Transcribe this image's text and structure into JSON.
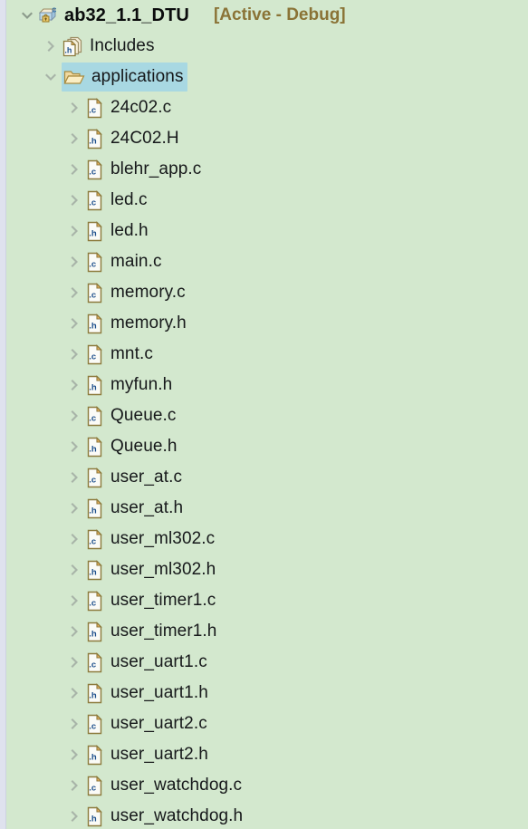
{
  "panel": {
    "name": "project-explorer",
    "background_color": "#d3e8ce",
    "selection_color": "#a8d8e2",
    "text_color": "#16181a",
    "build_config_color": "#8a7336"
  },
  "project": {
    "name": "ab32_1.1_DTU",
    "build_config": "[Active - Debug]",
    "icon": "c-project-icon",
    "expanded": true
  },
  "nodes": [
    {
      "label": "Includes",
      "icon": "includes-icon",
      "level": 1,
      "state": "collapsed",
      "selected": false
    },
    {
      "label": "applications",
      "icon": "folder-open-icon",
      "level": 1,
      "state": "expanded",
      "selected": true
    },
    {
      "label": "24c02.c",
      "icon": "c-file-icon",
      "level": 2,
      "state": "collapsed",
      "selected": false
    },
    {
      "label": "24C02.H",
      "icon": "h-file-icon",
      "level": 2,
      "state": "collapsed",
      "selected": false
    },
    {
      "label": "blehr_app.c",
      "icon": "c-file-icon",
      "level": 2,
      "state": "collapsed",
      "selected": false
    },
    {
      "label": "led.c",
      "icon": "c-file-icon",
      "level": 2,
      "state": "collapsed",
      "selected": false
    },
    {
      "label": "led.h",
      "icon": "h-file-icon",
      "level": 2,
      "state": "collapsed",
      "selected": false
    },
    {
      "label": "main.c",
      "icon": "c-file-icon",
      "level": 2,
      "state": "collapsed",
      "selected": false
    },
    {
      "label": "memory.c",
      "icon": "c-file-icon",
      "level": 2,
      "state": "collapsed",
      "selected": false
    },
    {
      "label": "memory.h",
      "icon": "h-file-icon",
      "level": 2,
      "state": "collapsed",
      "selected": false
    },
    {
      "label": "mnt.c",
      "icon": "c-file-icon",
      "level": 2,
      "state": "collapsed",
      "selected": false
    },
    {
      "label": "myfun.h",
      "icon": "h-file-icon",
      "level": 2,
      "state": "collapsed",
      "selected": false
    },
    {
      "label": "Queue.c",
      "icon": "c-file-icon",
      "level": 2,
      "state": "collapsed",
      "selected": false
    },
    {
      "label": "Queue.h",
      "icon": "h-file-icon",
      "level": 2,
      "state": "collapsed",
      "selected": false
    },
    {
      "label": "user_at.c",
      "icon": "c-file-icon",
      "level": 2,
      "state": "collapsed",
      "selected": false
    },
    {
      "label": "user_at.h",
      "icon": "h-file-icon",
      "level": 2,
      "state": "collapsed",
      "selected": false
    },
    {
      "label": "user_ml302.c",
      "icon": "c-file-icon",
      "level": 2,
      "state": "collapsed",
      "selected": false
    },
    {
      "label": "user_ml302.h",
      "icon": "h-file-icon",
      "level": 2,
      "state": "collapsed",
      "selected": false
    },
    {
      "label": "user_timer1.c",
      "icon": "c-file-icon",
      "level": 2,
      "state": "collapsed",
      "selected": false
    },
    {
      "label": "user_timer1.h",
      "icon": "h-file-icon",
      "level": 2,
      "state": "collapsed",
      "selected": false
    },
    {
      "label": "user_uart1.c",
      "icon": "c-file-icon",
      "level": 2,
      "state": "collapsed",
      "selected": false
    },
    {
      "label": "user_uart1.h",
      "icon": "h-file-icon",
      "level": 2,
      "state": "collapsed",
      "selected": false
    },
    {
      "label": "user_uart2.c",
      "icon": "c-file-icon",
      "level": 2,
      "state": "collapsed",
      "selected": false
    },
    {
      "label": "user_uart2.h",
      "icon": "h-file-icon",
      "level": 2,
      "state": "collapsed",
      "selected": false
    },
    {
      "label": "user_watchdog.c",
      "icon": "c-file-icon",
      "level": 2,
      "state": "collapsed",
      "selected": false
    },
    {
      "label": "user_watchdog.h",
      "icon": "h-file-icon",
      "level": 2,
      "state": "collapsed",
      "selected": false
    }
  ]
}
